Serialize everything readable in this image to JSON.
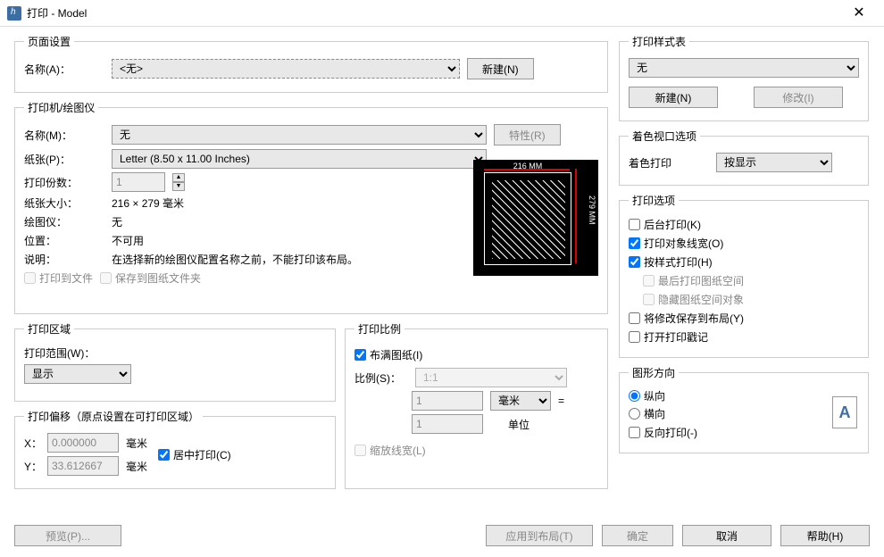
{
  "window": {
    "title": "打印 - Model"
  },
  "page_setup": {
    "legend": "页面设置",
    "name_label": "名称(A)：",
    "name_value": "<无>",
    "new_button": "新建(N)"
  },
  "printer": {
    "legend": "打印机/绘图仪",
    "name_label": "名称(M)：",
    "name_value": "无",
    "properties_button": "特性(R)",
    "paper_label": "纸张(P)：",
    "paper_value": "Letter (8.50 x 11.00 Inches)",
    "copies_label": "打印份数：",
    "copies_value": "1",
    "paper_size_label": "纸张大小：",
    "paper_size_value": "216 × 279   毫米",
    "plotter_label": "绘图仪：",
    "plotter_value": "无",
    "location_label": "位置：",
    "location_value": "不可用",
    "desc_label": "说明：",
    "desc_value": "在选择新的绘图仪配置名称之前，不能打印该布局。",
    "print_to_file": "打印到文件",
    "save_to_folder": "保存到图纸文件夹",
    "preview_top": "216 MM",
    "preview_right": "279 MM"
  },
  "print_area": {
    "legend": "打印区域",
    "range_label": "打印范围(W)：",
    "range_value": "显示"
  },
  "print_scale": {
    "legend": "打印比例",
    "fit_label": "布满图纸(I)",
    "scale_label": "比例(S)：",
    "scale_value": "1:1",
    "num1": "1",
    "unit_value": "毫米",
    "equals": "=",
    "num2": "1",
    "unit_label": "单位",
    "scale_lw": "缩放线宽(L)"
  },
  "offset": {
    "legend": "打印偏移（原点设置在可打印区域）",
    "x_label": "X：",
    "x_value": "0.000000",
    "x_unit": "毫米",
    "y_label": "Y：",
    "y_value": "33.612667",
    "y_unit": "毫米",
    "center_label": "居中打印(C)"
  },
  "style_table": {
    "legend": "打印样式表",
    "value": "无",
    "new_button": "新建(N)",
    "modify_button": "修改(I)"
  },
  "viewport": {
    "legend": "着色视口选项",
    "label": "着色打印",
    "value": "按显示"
  },
  "options": {
    "legend": "打印选项",
    "bg": "后台打印(K)",
    "lw": "打印对象线宽(O)",
    "style": "按样式打印(H)",
    "paper_last": "最后打印图纸空间",
    "hide": "隐藏图纸空间对象",
    "save_layout": "将修改保存到布局(Y)",
    "stamp": "打开打印戳记"
  },
  "orientation": {
    "legend": "图形方向",
    "portrait": "纵向",
    "landscape": "横向",
    "reverse": "反向打印(-)",
    "icon_letter": "A"
  },
  "buttons": {
    "preview": "预览(P)...",
    "apply": "应用到布局(T)",
    "ok": "确定",
    "cancel": "取消",
    "help": "帮助(H)"
  }
}
